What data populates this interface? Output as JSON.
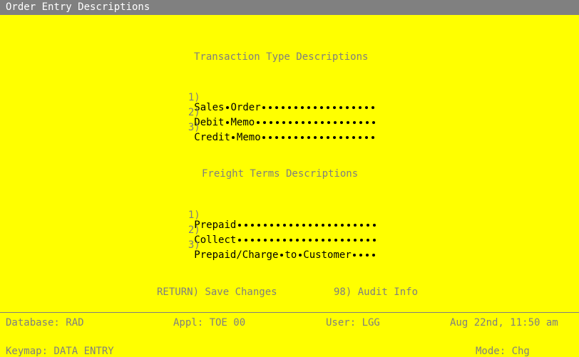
{
  "window": {
    "title": "Order Entry Descriptions"
  },
  "transaction_section": {
    "heading": "Transaction Type Descriptions",
    "fields": [
      {
        "num": "1)",
        "value": "Sales Order",
        "pad": 18
      },
      {
        "num": "2)",
        "value": "Debit Memo",
        "pad": 19
      },
      {
        "num": "3)",
        "value": "Credit Memo",
        "pad": 18
      }
    ]
  },
  "freight_section": {
    "heading": "Freight Terms Descriptions",
    "fields": [
      {
        "num": "1)",
        "value": "Prepaid",
        "pad": 22
      },
      {
        "num": "2)",
        "value": "Collect",
        "pad": 22
      },
      {
        "num": "3)",
        "value": "Prepaid/Charge to Customer",
        "pad": 4
      }
    ]
  },
  "function_keys": {
    "save": "RETURN) Save Changes",
    "audit": "98) Audit Info"
  },
  "status_bar": {
    "database": "Database: RAD",
    "appl": "Appl: TOE 00",
    "user": "User: LGG",
    "datetime": "Aug 22nd, 11:50 am"
  },
  "footer": {
    "keymap": "Keymap: DATA ENTRY",
    "mode": "Mode: Chg"
  },
  "colors": {
    "background": "#ffff00",
    "title_bar": "#808080",
    "label": "#7f7f7f",
    "input": "#000000"
  }
}
